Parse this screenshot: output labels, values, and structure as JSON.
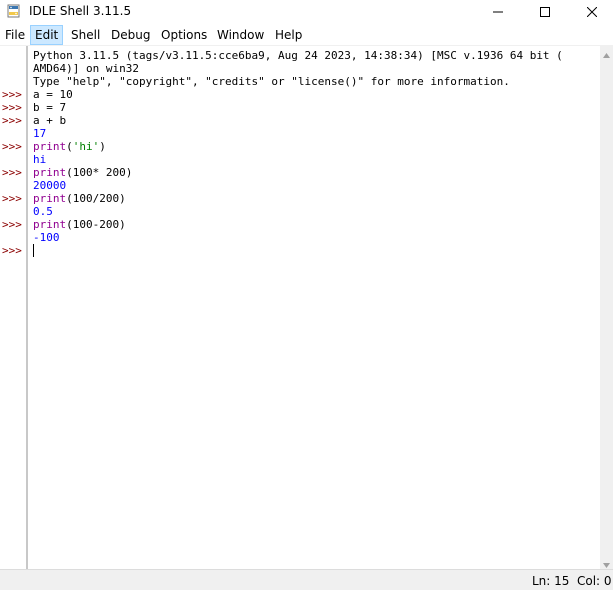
{
  "window": {
    "title": "IDLE Shell 3.11.5"
  },
  "menu": [
    {
      "label": "File"
    },
    {
      "label": "Edit"
    },
    {
      "label": "Shell"
    },
    {
      "label": "Debug"
    },
    {
      "label": "Options"
    },
    {
      "label": "Window"
    },
    {
      "label": "Help"
    }
  ],
  "shell": {
    "prompt": ">>>",
    "banner": [
      "Python 3.11.5 (tags/v3.11.5:cce6ba9, Aug 24 2023, 14:38:34) [MSC v.1936 64 bit (",
      "AMD64)] on win32",
      "Type \"help\", \"copyright\", \"credits\" or \"license()\" for more information."
    ],
    "session": [
      {
        "input": "a = 10"
      },
      {
        "input": "b = 7"
      },
      {
        "input": "a + b",
        "output": "17"
      },
      {
        "fn": "print",
        "args": "(",
        "str": "'hi'",
        "close": ")",
        "output": "hi"
      },
      {
        "fn": "print",
        "args": "(100* 200)",
        "output": "20000"
      },
      {
        "fn": "print",
        "args": "(100/200)",
        "output": "0.5"
      },
      {
        "fn": "print",
        "args": "(100-200)",
        "output": "-100"
      }
    ]
  },
  "status": {
    "line": "Ln: 15",
    "col": "Col: 0"
  },
  "colors": {
    "prompt": "#8b0000",
    "builtin": "#900090",
    "string": "#008000",
    "result": "#0000ff",
    "menu_active": "#cce8ff"
  },
  "icons": {
    "app": "python-idle-icon",
    "minimize": "minimize-icon",
    "maximize": "maximize-icon",
    "close": "close-icon"
  }
}
